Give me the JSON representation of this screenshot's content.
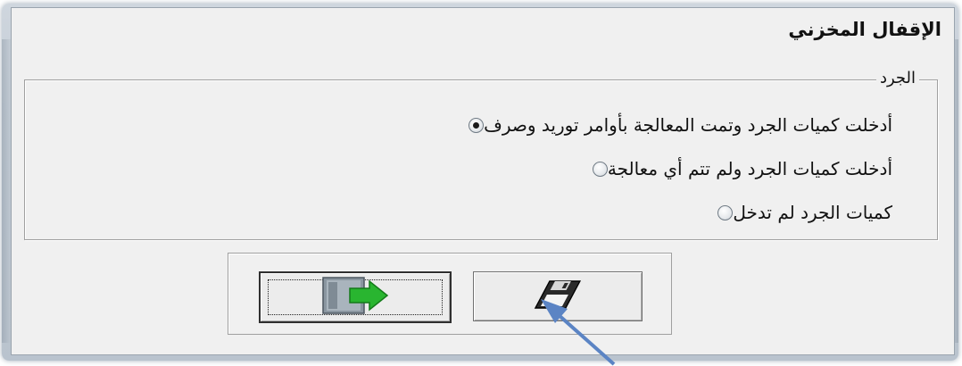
{
  "window": {
    "title": "الإقفال المخزني"
  },
  "inventory_group": {
    "label": "الجرد",
    "options": [
      {
        "label": "أدخلت كميات الجرد وتمت المعالجة بأوامر توريد وصرف",
        "checked": true
      },
      {
        "label": "أدخلت كميات الجرد ولم تتم أي معالجة",
        "checked": false
      },
      {
        "label": "كميات الجرد لم تدخل",
        "checked": false
      }
    ]
  },
  "buttons": {
    "exit_icon": "exit-door-icon",
    "save_icon": "floppy-disk-icon"
  },
  "annotation": {
    "arrow_color": "#5b84c4"
  }
}
